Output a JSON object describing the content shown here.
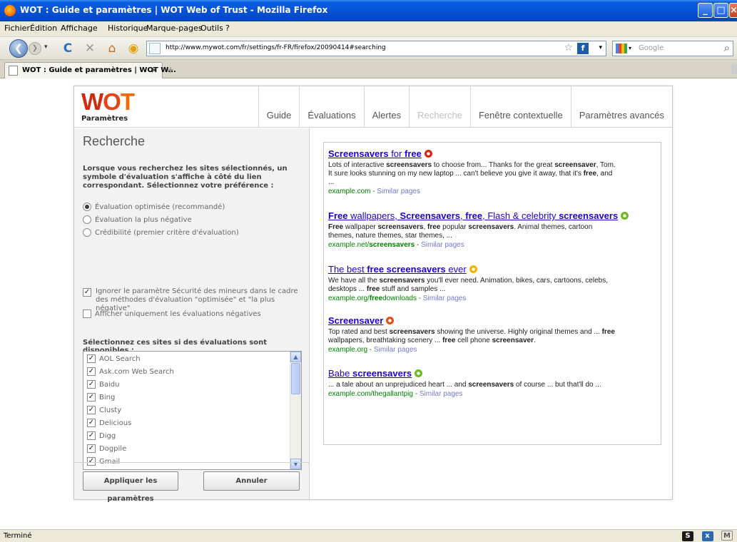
{
  "window": {
    "title": "WOT : Guide et paramètres | WOT Web of Trust - Mozilla Firefox"
  },
  "menu": [
    "Fichier",
    "Édition",
    "Affichage",
    "Historique",
    "Marque-pages",
    "Outils",
    "?"
  ],
  "navbar": {
    "url": "http://www.mywot.com/fr/settings/fr-FR/firefox/20090414#searching",
    "search_placeholder": "Google"
  },
  "tab": {
    "title": "WOT : Guide et paramètres | WOT W...",
    "new_tab": "+"
  },
  "header": {
    "logo_w": "W",
    "logo_o": "O",
    "logo_t": "T",
    "logo_sub": "Paramètres",
    "tabs": [
      {
        "label": "Guide",
        "enabled": true
      },
      {
        "label": "Évaluations",
        "enabled": true
      },
      {
        "label": "Alertes",
        "enabled": true
      },
      {
        "label": "Recherche",
        "enabled": false
      },
      {
        "label": "Fenêtre contextuelle",
        "enabled": true
      },
      {
        "label": "Paramètres avancés",
        "enabled": true
      }
    ]
  },
  "settings": {
    "heading": "Recherche",
    "intro": "Lorsque vous recherchez les sites sélectionnés, un symbole d'évaluation s'affiche à côté du lien correspondant. Sélectionnez votre préférence :",
    "options": [
      {
        "label": "Évaluation optimisée (recommandé)",
        "selected": true
      },
      {
        "label": "Évaluation la plus négative",
        "selected": false
      },
      {
        "label": "Crédibilité (premier critère d'évaluation)",
        "selected": false
      }
    ],
    "ignore_child_safety": {
      "line1": "Ignorer le paramètre Sécurité des mineurs dans le cadre",
      "line2": "des méthodes d'évaluation \"optimisée\" et \"la plus négative\"",
      "checked": true
    },
    "only_negative": {
      "label": "Afficher uniquement les évaluations négatives",
      "checked": false
    },
    "sites_label": "Sélectionnez ces sites si des évaluations sont disponibles :",
    "sites": [
      {
        "label": "AOL Search",
        "checked": true
      },
      {
        "label": "Ask.com Web Search",
        "checked": true
      },
      {
        "label": "Baidu",
        "checked": true
      },
      {
        "label": "Bing",
        "checked": true
      },
      {
        "label": "Clusty",
        "checked": true
      },
      {
        "label": "Delicious",
        "checked": true
      },
      {
        "label": "Digg",
        "checked": true
      },
      {
        "label": "Dogpile",
        "checked": true
      },
      {
        "label": "Gmail",
        "checked": true
      }
    ],
    "apply_label": "Appliquer les paramètres",
    "cancel_label": "Annuler"
  },
  "results": [
    {
      "title_parts": [
        {
          "t": "Screensavers",
          "b": true
        },
        {
          "t": " for ",
          "b": false
        },
        {
          "t": "free",
          "b": true
        }
      ],
      "rating_color": "#d9230f",
      "snippet_lines": [
        [
          {
            "t": "Lots of interactive ",
            "b": false
          },
          {
            "t": "screensavers",
            "b": true
          },
          {
            "t": " to choose from... Thanks for the great ",
            "b": false
          },
          {
            "t": "screensaver",
            "b": true
          },
          {
            "t": ", Tom.",
            "b": false
          }
        ],
        [
          {
            "t": "It sure looks stunning on my new laptop ... can't believe you give it away, that it's ",
            "b": false
          },
          {
            "t": "free",
            "b": true
          },
          {
            "t": ", and",
            "b": false
          }
        ],
        [
          {
            "t": "...",
            "b": false
          }
        ]
      ],
      "meta_parts": [
        {
          "t": "example.com",
          "b": false
        }
      ],
      "similar": "Similar pages"
    },
    {
      "title_parts": [
        {
          "t": "Free",
          "b": true
        },
        {
          "t": " wallpapers, ",
          "b": false
        },
        {
          "t": "Screensavers",
          "b": true
        },
        {
          "t": ", ",
          "b": false
        },
        {
          "t": "free",
          "b": true
        },
        {
          "t": ", Flash & celebrity ",
          "b": false
        },
        {
          "t": "screensavers",
          "b": true
        }
      ],
      "rating_color": "#6bbd1f",
      "snippet_lines": [
        [
          {
            "t": "Free",
            "b": true
          },
          {
            "t": " wallpaper ",
            "b": false
          },
          {
            "t": "screensavers",
            "b": true
          },
          {
            "t": ", ",
            "b": false
          },
          {
            "t": "free",
            "b": true
          },
          {
            "t": " popular ",
            "b": false
          },
          {
            "t": "screensavers",
            "b": true
          },
          {
            "t": ". Animal themes, cartoon",
            "b": false
          }
        ],
        [
          {
            "t": "themes, nature themes, star themes, ...",
            "b": false
          }
        ]
      ],
      "meta_parts": [
        {
          "t": "example.net/",
          "b": false
        },
        {
          "t": "screensavers",
          "b": true
        }
      ],
      "similar": "Similar pages"
    },
    {
      "title_parts": [
        {
          "t": "The best ",
          "b": false
        },
        {
          "t": "free screensavers",
          "b": true
        },
        {
          "t": " ever",
          "b": false
        }
      ],
      "rating_color": "#f0b400",
      "snippet_lines": [
        [
          {
            "t": "We have all the ",
            "b": false
          },
          {
            "t": "screensavers",
            "b": true
          },
          {
            "t": " you'll ever need. Animation, bikes, cars, cartoons, celebs,",
            "b": false
          }
        ],
        [
          {
            "t": "desktops ... ",
            "b": false
          },
          {
            "t": "free",
            "b": true
          },
          {
            "t": " stuff and samples ...",
            "b": false
          }
        ]
      ],
      "meta_parts": [
        {
          "t": "example.org/",
          "b": false
        },
        {
          "t": "free",
          "b": true
        },
        {
          "t": "downloads",
          "b": false
        }
      ],
      "similar": "Similar pages"
    },
    {
      "title_parts": [
        {
          "t": "Screensaver",
          "b": true
        }
      ],
      "rating_color": "#e4501c",
      "snippet_lines": [
        [
          {
            "t": "Top rated and best ",
            "b": false
          },
          {
            "t": "screensavers",
            "b": true
          },
          {
            "t": " showing the universe. Highly original themes and ... ",
            "b": false
          },
          {
            "t": "free",
            "b": true
          }
        ],
        [
          {
            "t": "wallpapers, breathtaking scenery ... ",
            "b": false
          },
          {
            "t": "free",
            "b": true
          },
          {
            "t": " cell phone ",
            "b": false
          },
          {
            "t": "screensaver",
            "b": true
          },
          {
            "t": ".",
            "b": false
          }
        ]
      ],
      "meta_parts": [
        {
          "t": "example.org",
          "b": false
        }
      ],
      "similar": "Similar pages"
    },
    {
      "title_parts": [
        {
          "t": "Babe ",
          "b": false
        },
        {
          "t": "screensavers",
          "b": true
        }
      ],
      "rating_color": "#6bbd1f",
      "snippet_lines": [
        [
          {
            "t": "... a tale about an unprejudiced heart ... and ",
            "b": false
          },
          {
            "t": "screensavers",
            "b": true
          },
          {
            "t": " of course ... but that'll do ...",
            "b": false
          }
        ]
      ],
      "meta_parts": [
        {
          "t": "example.com/thegallantpig",
          "b": false
        }
      ],
      "similar": "Similar pages"
    }
  ],
  "status": {
    "text": "Terminé"
  }
}
